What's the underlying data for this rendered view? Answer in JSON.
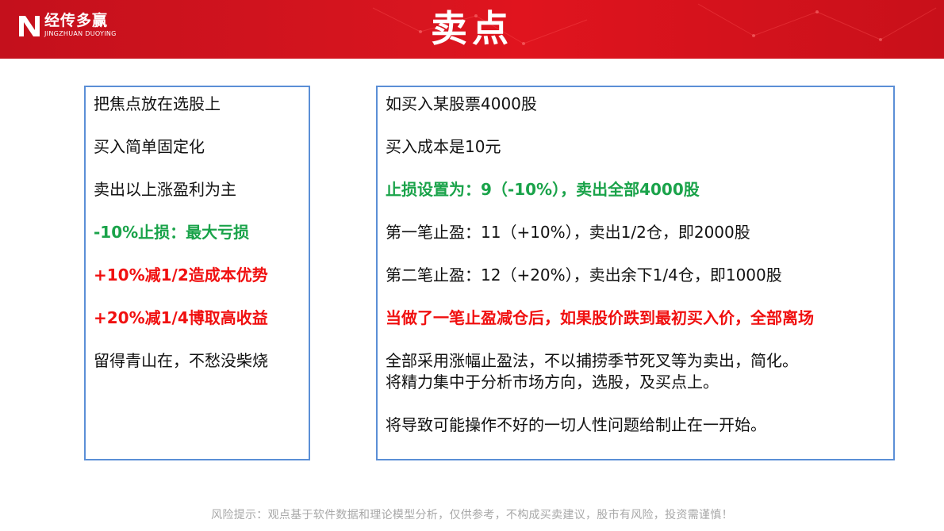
{
  "header": {
    "brand_cn": "经传多赢",
    "brand_en": "JINGZHUAN DUOYING",
    "title": "卖点"
  },
  "left_panel": {
    "lines": [
      "把焦点放在选股上",
      "买入简单固定化",
      "卖出以上涨盈利为主",
      "-10%止损：最大亏损",
      "+10%减1/2造成本优势",
      "+20%减1/4博取高收益",
      "留得青山在，不愁没柴烧"
    ]
  },
  "right_panel": {
    "lines": [
      "如买入某股票4000股",
      "买入成本是10元",
      "止损设置为：9（-10%），卖出全部4000股",
      "第一笔止盈：11（+10%），卖出1/2仓，即2000股",
      "第二笔止盈：12（+20%），卖出余下1/4仓，即1000股",
      "当做了一笔止盈减仓后，如果股价跌到最初买入价，全部离场",
      "全部采用涨幅止盈法，不以捕捞季节死叉等为卖出，简化。",
      "将精力集中于分析市场方向，选股，及买点上。",
      "将导致可能操作不好的一切人性问题给制止在一开始。"
    ]
  },
  "footer": {
    "disclaimer": "风险提示：观点基于软件数据和理论模型分析，仅供参考，不构成买卖建议，股市有风险，投资需谨慎！"
  },
  "colors": {
    "header_red": "#d8151f",
    "box_border": "#5b8fd6",
    "green": "#1aa34a",
    "red": "#f01010"
  }
}
